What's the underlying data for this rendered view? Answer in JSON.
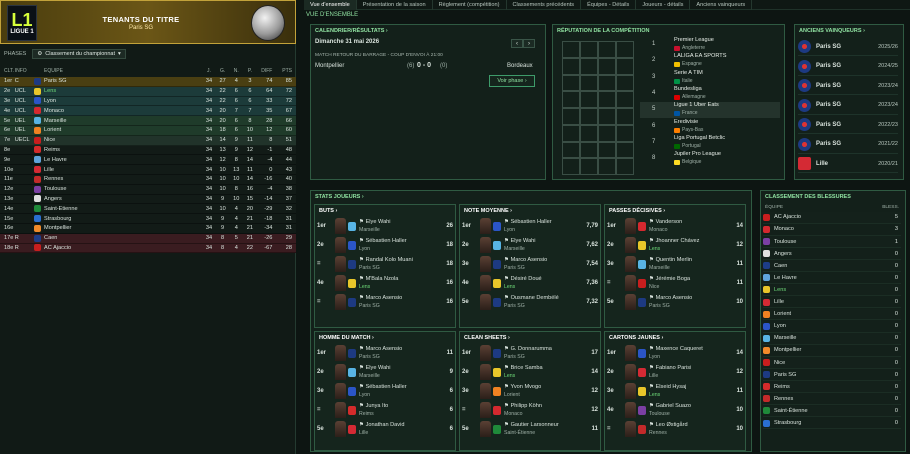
{
  "league": {
    "logo_mark": "L1",
    "logo_text": "LIGUE 1",
    "header_title": "TENANTS DU TITRE",
    "header_subtitle": "Paris SG"
  },
  "phases": {
    "label": "PHASES",
    "selected": "Classement du championnat"
  },
  "table_headers": [
    "CLT.",
    "INFO",
    "ÉQUIPE",
    "J.",
    "G.",
    "N.",
    "P.",
    "DIFF",
    "PTS"
  ],
  "standings": [
    {
      "pos": "1er",
      "info": "C",
      "team": "Paris SG",
      "j": "34",
      "g": "27",
      "n": "4",
      "p": "3",
      "diff": "74",
      "pts": "85",
      "bg": "#4a3f12",
      "crest": "#1d3a82"
    },
    {
      "pos": "2e",
      "info": "UCL",
      "team": "Lens",
      "j": "34",
      "g": "22",
      "n": "6",
      "p": "6",
      "diff": "64",
      "pts": "72",
      "bg": "#1c3b3a",
      "crest": "#e8c62a",
      "green": true
    },
    {
      "pos": "3e",
      "info": "UCL",
      "team": "Lyon",
      "j": "34",
      "g": "22",
      "n": "6",
      "p": "6",
      "diff": "33",
      "pts": "72",
      "bg": "#1c3b3a",
      "crest": "#2b55c7"
    },
    {
      "pos": "4e",
      "info": "UCL",
      "team": "Monaco",
      "j": "34",
      "g": "20",
      "n": "7",
      "p": "7",
      "diff": "35",
      "pts": "67",
      "bg": "#1c3b3a",
      "crest": "#d4292f"
    },
    {
      "pos": "5e",
      "info": "UEL",
      "team": "Marseille",
      "j": "34",
      "g": "20",
      "n": "6",
      "p": "8",
      "diff": "28",
      "pts": "66",
      "bg": "#1f3b2a",
      "crest": "#58b4e4"
    },
    {
      "pos": "6e",
      "info": "UEL",
      "team": "Lorient",
      "j": "34",
      "g": "18",
      "n": "6",
      "p": "10",
      "diff": "12",
      "pts": "60",
      "bg": "#1f3b2a",
      "crest": "#f08222"
    },
    {
      "pos": "7e",
      "info": "UECL",
      "team": "Nice",
      "j": "34",
      "g": "14",
      "n": "9",
      "p": "11",
      "diff": "8",
      "pts": "51",
      "bg": "#21332a",
      "crest": "#c81e1e"
    },
    {
      "pos": "8e",
      "info": "",
      "team": "Reims",
      "j": "34",
      "g": "13",
      "n": "9",
      "p": "12",
      "diff": "-1",
      "pts": "48",
      "bg": "#121b17",
      "crest": "#d32b2b"
    },
    {
      "pos": "9e",
      "info": "",
      "team": "Le Havre",
      "j": "34",
      "g": "12",
      "n": "8",
      "p": "14",
      "diff": "-4",
      "pts": "44",
      "bg": "#121b17",
      "crest": "#5fa4dc"
    },
    {
      "pos": "10e",
      "info": "",
      "team": "Lille",
      "j": "34",
      "g": "10",
      "n": "13",
      "p": "11",
      "diff": "0",
      "pts": "43",
      "bg": "#121b17",
      "crest": "#d42a34"
    },
    {
      "pos": "11e",
      "info": "",
      "team": "Rennes",
      "j": "34",
      "g": "10",
      "n": "10",
      "p": "14",
      "diff": "-16",
      "pts": "40",
      "bg": "#121b17",
      "crest": "#c22a2a"
    },
    {
      "pos": "12e",
      "info": "",
      "team": "Toulouse",
      "j": "34",
      "g": "10",
      "n": "8",
      "p": "16",
      "diff": "-4",
      "pts": "38",
      "bg": "#121b17",
      "crest": "#7b3fa3"
    },
    {
      "pos": "13e",
      "info": "",
      "team": "Angers",
      "j": "34",
      "g": "9",
      "n": "10",
      "p": "15",
      "diff": "-14",
      "pts": "37",
      "bg": "#121b17",
      "crest": "#e0e0e0"
    },
    {
      "pos": "14e",
      "info": "",
      "team": "Saint-Étienne",
      "j": "34",
      "g": "10",
      "n": "4",
      "p": "20",
      "diff": "-29",
      "pts": "32",
      "bg": "#121b17",
      "crest": "#1f8a3a"
    },
    {
      "pos": "15e",
      "info": "",
      "team": "Strasbourg",
      "j": "34",
      "g": "9",
      "n": "4",
      "p": "21",
      "diff": "-18",
      "pts": "31",
      "bg": "#121b17",
      "crest": "#2a6fd0"
    },
    {
      "pos": "16e",
      "info": "",
      "team": "Montpellier",
      "j": "34",
      "g": "9",
      "n": "4",
      "p": "21",
      "diff": "-34",
      "pts": "31",
      "bg": "#121b17",
      "crest": "#f08a2a"
    },
    {
      "pos": "17e",
      "info": "R",
      "team": "Caen",
      "j": "34",
      "g": "8",
      "n": "5",
      "p": "21",
      "diff": "-26",
      "pts": "29",
      "bg": "#3a1c20",
      "crest": "#1d3d88"
    },
    {
      "pos": "18e",
      "info": "R",
      "team": "AC Ajaccio",
      "j": "34",
      "g": "8",
      "n": "4",
      "p": "22",
      "diff": "-67",
      "pts": "28",
      "bg": "#3a1c20",
      "crest": "#c81e1e"
    }
  ],
  "tabs": [
    "Vue d'ensemble",
    "Présentation de la saison",
    "Règlement (compétition)",
    "Classements précédents",
    "Équipes - Détails",
    "Joueurs - détails",
    "Anciens vainqueurs"
  ],
  "crumb": "VUE D'ENSEMBLE",
  "calendar": {
    "title": "CALENDRIER/RÉSULTATS",
    "date": "Dimanche 31 mai 2026",
    "match_label": "MATCH RETOUR DU BARRAGE - COUP D'ENVOI À 21:00",
    "home": "Montpellier",
    "home_agg": "(6)",
    "score": "0 - 0",
    "away_agg": "(0)",
    "away": "Bordeaux",
    "button": "Voir phase"
  },
  "reputation": {
    "title": "RÉPUTATION DE LA COMPÉTITION",
    "leagues": [
      {
        "n": "1",
        "name": "Premier League",
        "country": "Angleterre",
        "flag": "#c8102e"
      },
      {
        "n": "2",
        "name": "LALIGA EA SPORTS",
        "country": "Espagne",
        "flag": "#f1bf00"
      },
      {
        "n": "3",
        "name": "Serie A TIM",
        "country": "Italie",
        "flag": "#009246"
      },
      {
        "n": "4",
        "name": "Bundesliga",
        "country": "Allemagne",
        "flag": "#dd0000"
      },
      {
        "n": "5",
        "name": "Ligue 1 Uber Eats",
        "country": "France",
        "flag": "#0055a4"
      },
      {
        "n": "6",
        "name": "Eredivisie",
        "country": "Pays-Bas",
        "flag": "#ff7f00"
      },
      {
        "n": "7",
        "name": "Liga Portugal Betclic",
        "country": "Portugal",
        "flag": "#006600"
      },
      {
        "n": "8",
        "name": "Jupiler Pro League",
        "country": "Belgique",
        "flag": "#fdda24"
      }
    ]
  },
  "winners": {
    "title": "ANCIENS VAINQUEURS",
    "items": [
      {
        "team": "Paris SG",
        "year": "2025/26"
      },
      {
        "team": "Paris SG",
        "year": "2024/25"
      },
      {
        "team": "Paris SG",
        "year": "2023/24"
      },
      {
        "team": "Paris SG",
        "year": "2023/24"
      },
      {
        "team": "Paris SG",
        "year": "2022/23"
      },
      {
        "team": "Paris SG",
        "year": "2021/22"
      },
      {
        "team": "Lille",
        "year": "2020/21"
      }
    ]
  },
  "stats_title": "STATS JOUEURS",
  "stat_blocks": [
    {
      "title": "BUTS",
      "players": [
        {
          "rk": "1er",
          "name": "Elye Wahi",
          "club": "Marseille",
          "val": "26",
          "crest": "#58b4e4"
        },
        {
          "rk": "2e",
          "name": "Sébastien Haller",
          "club": "Lyon",
          "val": "18",
          "crest": "#2b55c7"
        },
        {
          "rk": "=",
          "name": "Randal Kolo Muani",
          "club": "Paris SG",
          "val": "18",
          "crest": "#1d3a82"
        },
        {
          "rk": "4e",
          "name": "M'Bala Nzola",
          "club": "Lens",
          "val": "16",
          "crest": "#e8c62a",
          "green": true
        },
        {
          "rk": "=",
          "name": "Marco Asensio",
          "club": "Paris SG",
          "val": "16",
          "crest": "#1d3a82"
        }
      ]
    },
    {
      "title": "NOTE MOYENNE",
      "players": [
        {
          "rk": "1er",
          "name": "Sébastien Haller",
          "club": "Lyon",
          "val": "7,79",
          "crest": "#2b55c7"
        },
        {
          "rk": "2e",
          "name": "Elye Wahi",
          "club": "Marseille",
          "val": "7,62",
          "crest": "#58b4e4"
        },
        {
          "rk": "3e",
          "name": "Marco Asensio",
          "club": "Paris SG",
          "val": "7,54",
          "crest": "#1d3a82"
        },
        {
          "rk": "4e",
          "name": "Désiré Doué",
          "club": "Lens",
          "val": "7,36",
          "crest": "#e8c62a",
          "green": true
        },
        {
          "rk": "5e",
          "name": "Ousmane Dembélé",
          "club": "Paris SG",
          "val": "7,32",
          "crest": "#1d3a82"
        }
      ]
    },
    {
      "title": "PASSES DÉCISIVES",
      "players": [
        {
          "rk": "1er",
          "name": "Vanderson",
          "club": "Monaco",
          "val": "14",
          "crest": "#d4292f"
        },
        {
          "rk": "2e",
          "name": "Jhoanner Chávez",
          "club": "Lens",
          "val": "12",
          "crest": "#e8c62a",
          "green": true
        },
        {
          "rk": "3e",
          "name": "Quentin Merlin",
          "club": "Marseille",
          "val": "11",
          "crest": "#58b4e4"
        },
        {
          "rk": "=",
          "name": "Jérémie Boga",
          "club": "Nice",
          "val": "11",
          "crest": "#c81e1e"
        },
        {
          "rk": "5e",
          "name": "Marco Asensio",
          "club": "Paris SG",
          "val": "10",
          "crest": "#1d3a82"
        }
      ]
    },
    {
      "title": "HOMME DU MATCH",
      "players": [
        {
          "rk": "1er",
          "name": "Marco Asensio",
          "club": "Paris SG",
          "val": "11",
          "crest": "#1d3a82"
        },
        {
          "rk": "2e",
          "name": "Elye Wahi",
          "club": "Marseille",
          "val": "9",
          "crest": "#58b4e4"
        },
        {
          "rk": "3e",
          "name": "Sébastien Haller",
          "club": "Lyon",
          "val": "6",
          "crest": "#2b55c7"
        },
        {
          "rk": "=",
          "name": "Junya Ito",
          "club": "Reims",
          "val": "6",
          "crest": "#d32b2b"
        },
        {
          "rk": "5e",
          "name": "Jonathan David",
          "club": "Lille",
          "val": "6",
          "crest": "#d42a34"
        }
      ]
    },
    {
      "title": "CLEAN SHEETS",
      "players": [
        {
          "rk": "1er",
          "name": "G. Donnarumma",
          "club": "Paris SG",
          "val": "17",
          "crest": "#1d3a82"
        },
        {
          "rk": "2e",
          "name": "Brice Samba",
          "club": "Lens",
          "val": "14",
          "crest": "#e8c62a",
          "green": true
        },
        {
          "rk": "3e",
          "name": "Yvon Mvogo",
          "club": "Lorient",
          "val": "12",
          "crest": "#f08222"
        },
        {
          "rk": "=",
          "name": "Philipp Köhn",
          "club": "Monaco",
          "val": "12",
          "crest": "#d4292f"
        },
        {
          "rk": "5e",
          "name": "Gautier Larsonneur",
          "club": "Saint-Étienne",
          "val": "11",
          "crest": "#1f8a3a"
        }
      ]
    },
    {
      "title": "CARTONS JAUNES",
      "players": [
        {
          "rk": "1er",
          "name": "Maxence Caqueret",
          "club": "Lyon",
          "val": "14",
          "crest": "#2b55c7"
        },
        {
          "rk": "2e",
          "name": "Fabiano Parisi",
          "club": "Lille",
          "val": "12",
          "crest": "#d42a34"
        },
        {
          "rk": "3e",
          "name": "Elseid Hysaj",
          "club": "Lens",
          "val": "11",
          "crest": "#e8c62a",
          "green": true
        },
        {
          "rk": "4e",
          "name": "Gabriel Suazo",
          "club": "Toulouse",
          "val": "10",
          "crest": "#7b3fa3"
        },
        {
          "rk": "=",
          "name": "Leo Østigård",
          "club": "Rennes",
          "val": "10",
          "crest": "#c22a2a"
        }
      ]
    }
  ],
  "injuries": {
    "title": "CLASSEMENT DES BLESSURES",
    "col_team": "ÉQUIPE",
    "col_val": "BLESS.",
    "items": [
      {
        "team": "AC Ajaccio",
        "val": "5",
        "crest": "#c81e1e"
      },
      {
        "team": "Monaco",
        "val": "3",
        "crest": "#d4292f"
      },
      {
        "team": "Toulouse",
        "val": "1",
        "crest": "#7b3fa3"
      },
      {
        "team": "Angers",
        "val": "0",
        "crest": "#e0e0e0"
      },
      {
        "team": "Caen",
        "val": "0",
        "crest": "#1d3d88"
      },
      {
        "team": "Le Havre",
        "val": "0",
        "crest": "#5fa4dc"
      },
      {
        "team": "Lens",
        "val": "0",
        "crest": "#e8c62a",
        "green": true
      },
      {
        "team": "Lille",
        "val": "0",
        "crest": "#d42a34"
      },
      {
        "team": "Lorient",
        "val": "0",
        "crest": "#f08222"
      },
      {
        "team": "Lyon",
        "val": "0",
        "crest": "#2b55c7"
      },
      {
        "team": "Marseille",
        "val": "0",
        "crest": "#58b4e4"
      },
      {
        "team": "Montpellier",
        "val": "0",
        "crest": "#f08a2a"
      },
      {
        "team": "Nice",
        "val": "0",
        "crest": "#c81e1e"
      },
      {
        "team": "Paris SG",
        "val": "0",
        "crest": "#1d3a82"
      },
      {
        "team": "Reims",
        "val": "0",
        "crest": "#d32b2b"
      },
      {
        "team": "Rennes",
        "val": "0",
        "crest": "#c22a2a"
      },
      {
        "team": "Saint-Étienne",
        "val": "0",
        "crest": "#1f8a3a"
      },
      {
        "team": "Strasbourg",
        "val": "0",
        "crest": "#2a6fd0"
      }
    ]
  }
}
